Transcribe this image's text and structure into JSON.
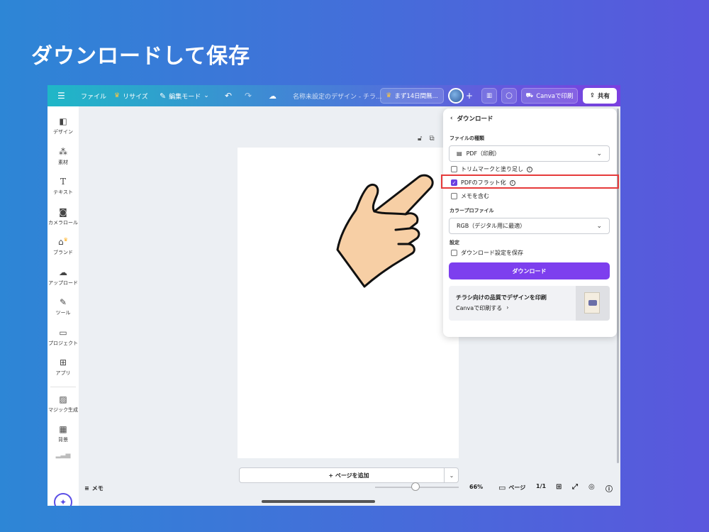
{
  "slide": {
    "title": "ダウンロードして保存"
  },
  "topbar": {
    "file": "ファイル",
    "resize": "リサイズ",
    "edit_mode": "編集モード",
    "doc_title": "名称未設定のデザイン - チラ...",
    "trial": "まず14日間無...",
    "print": "Canvaで印刷",
    "share": "共有"
  },
  "sidebar": {
    "items": [
      {
        "label": "デザイン",
        "icon": "design-icon"
      },
      {
        "label": "素材",
        "icon": "elements-icon"
      },
      {
        "label": "テキスト",
        "icon": "text-icon"
      },
      {
        "label": "カメラロール",
        "icon": "camera-icon"
      },
      {
        "label": "ブランド",
        "icon": "brand-icon"
      },
      {
        "label": "アップロード",
        "icon": "upload-icon"
      },
      {
        "label": "ツール",
        "icon": "tools-icon"
      },
      {
        "label": "プロジェクト",
        "icon": "folder-icon"
      },
      {
        "label": "アプリ",
        "icon": "apps-icon"
      },
      {
        "label": "マジック生成",
        "icon": "magic-media-icon"
      },
      {
        "label": "背景",
        "icon": "background-icon"
      }
    ]
  },
  "canvas": {
    "add_page": "+ ページを追加"
  },
  "bottombar": {
    "memo": "メモ",
    "zoom": "66%",
    "zoom_level": 0.66,
    "page_label": "ページ",
    "page_count": "1/1"
  },
  "download_panel": {
    "title": "ダウンロード",
    "file_type_label": "ファイルの種類",
    "file_type_value": "PDF（印刷）",
    "crop_marks": "トリムマークと塗り足し",
    "flatten": "PDFのフラット化",
    "flatten_checked": true,
    "include_notes": "メモを含む",
    "color_profile_label": "カラープロファイル",
    "color_profile_value": "RGB（デジタル用に最適）",
    "settings_label": "設定",
    "save_settings": "ダウンロード設定を保存",
    "download_button": "ダウンロード",
    "promo_title": "チラシ向けの品質でデザインを印刷",
    "promo_link": "Canvaで印刷する"
  },
  "colors": {
    "accent": "#7d3fee",
    "highlight": "#e63b3b",
    "background_start": "#2d86d6",
    "background_end": "#5a57dd"
  }
}
